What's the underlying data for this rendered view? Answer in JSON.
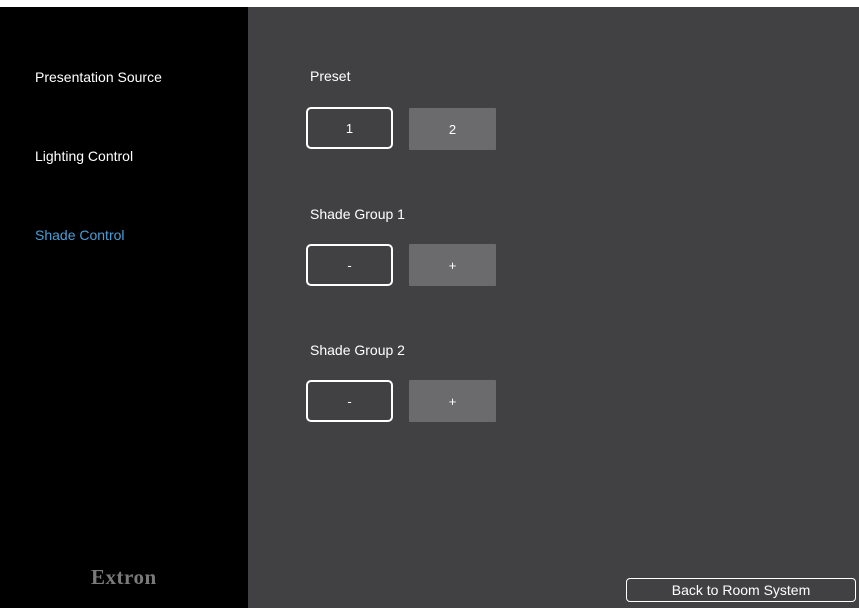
{
  "sidebar": {
    "items": [
      {
        "label": "Presentation Source",
        "active": false
      },
      {
        "label": "Lighting Control",
        "active": false
      },
      {
        "label": "Shade Control",
        "active": true
      }
    ],
    "brand": "Extron"
  },
  "main": {
    "preset": {
      "label": "Preset",
      "buttons": [
        "1",
        "2"
      ]
    },
    "shade_group_1": {
      "label": "Shade Group 1",
      "buttons": [
        "-",
        "+"
      ]
    },
    "shade_group_2": {
      "label": "Shade Group 2",
      "buttons": [
        "-",
        "+"
      ]
    },
    "back_label": "Back to Room System"
  },
  "colors": {
    "sidebar_bg": "#000000",
    "main_bg": "#414143",
    "active_nav": "#4a9fd8",
    "filled_button": "#6b6b6d"
  }
}
